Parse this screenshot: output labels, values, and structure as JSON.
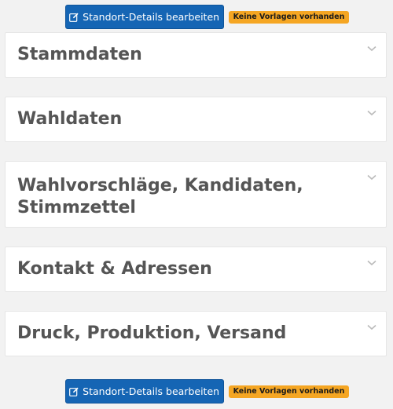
{
  "actions_top": {
    "edit_button_label": "Standort-Details bearbeiten",
    "badge_label": "Keine Vorlagen vorhanden"
  },
  "actions_bottom": {
    "edit_button_label": "Standort-Details bearbeiten",
    "badge_label": "Keine Vorlagen vorhanden"
  },
  "sections": [
    {
      "title": "Stammdaten"
    },
    {
      "title": "Wahldaten"
    },
    {
      "title": "Wahlvorschläge, Kandidaten, Stimmzettel"
    },
    {
      "title": "Kontakt & Adressen"
    },
    {
      "title": "Druck, Produktion, Versand"
    }
  ],
  "icons": {
    "button_icon": "edit-icon",
    "panel_icon": "chevron-down-icon"
  },
  "colors": {
    "primary_button": "#1565b4",
    "badge_warning": "#f5a623",
    "panel_title": "#555555",
    "page_background": "#f2f2f2"
  }
}
